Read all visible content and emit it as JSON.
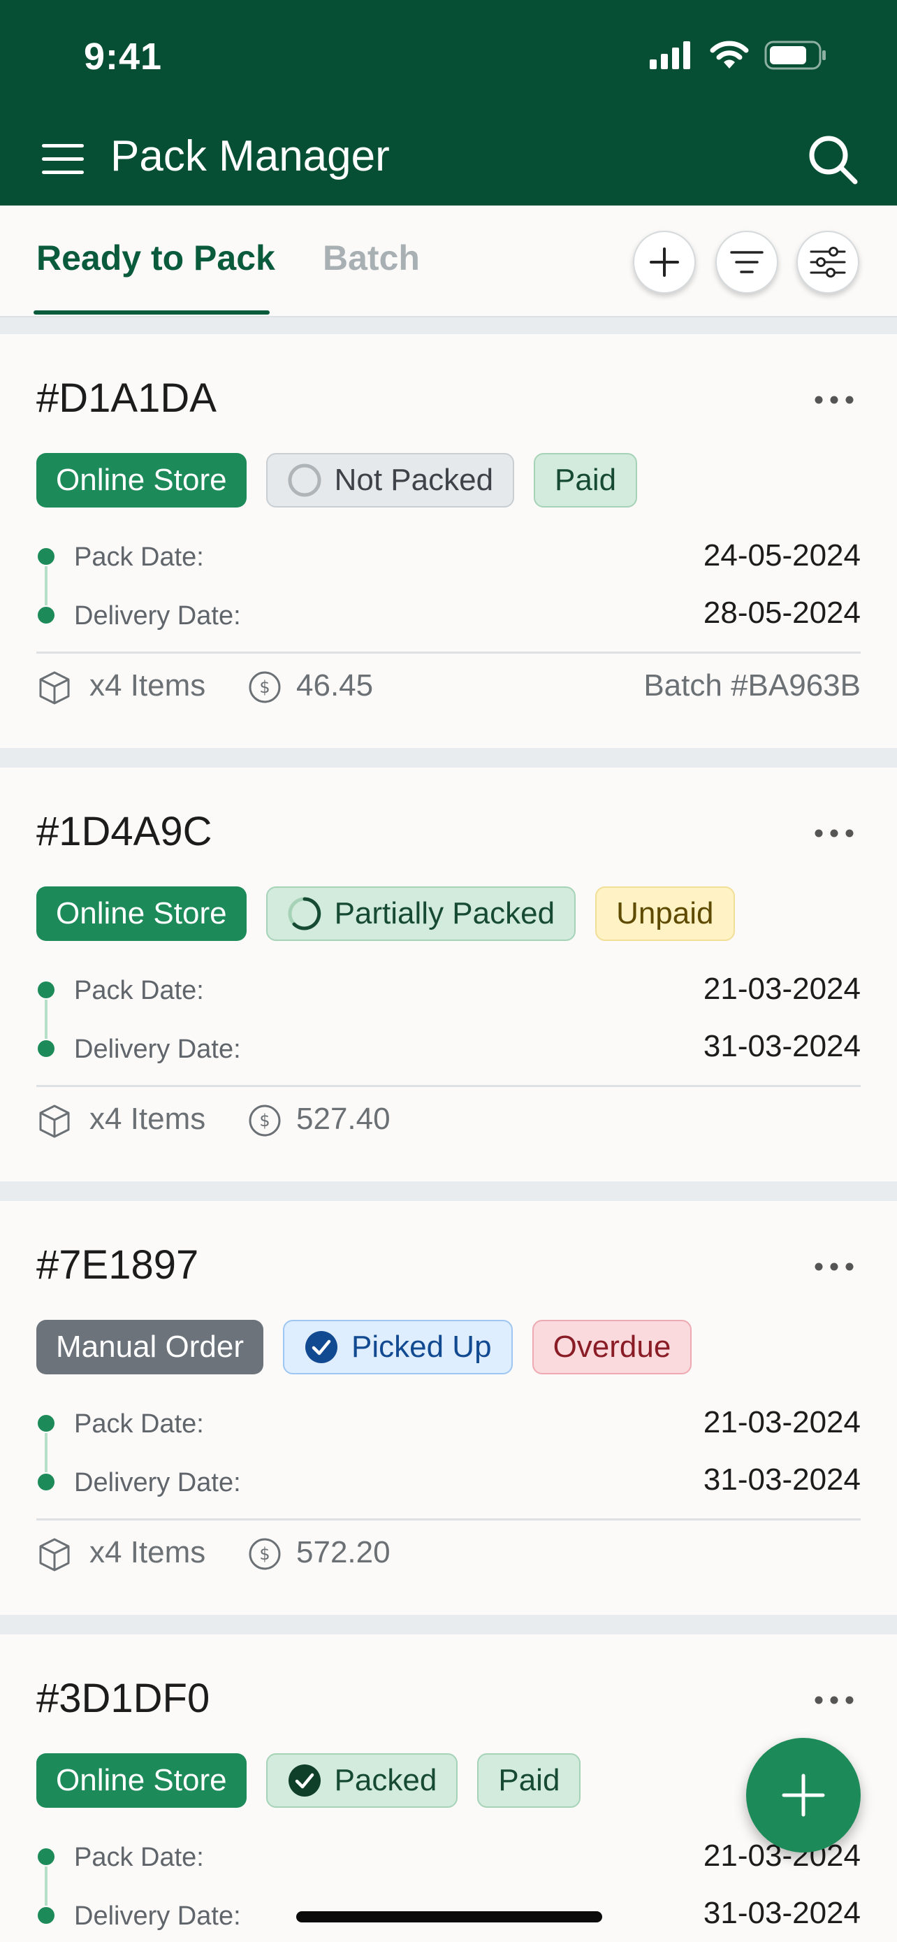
{
  "status_bar": {
    "time": "9:41"
  },
  "app": {
    "title": "Pack Manager"
  },
  "tabs": [
    {
      "label": "Ready to Pack"
    },
    {
      "label": "Batch"
    }
  ],
  "orders": [
    {
      "id": "#D1A1DA",
      "source": "Online Store",
      "pack_status": "Not Packed",
      "payment_status": "Paid",
      "pack_date_label": "Pack Date:",
      "pack_date": "24-05-2024",
      "delivery_date_label": "Delivery Date:",
      "delivery_date": "28-05-2024",
      "items": "x4 Items",
      "amount": "46.45",
      "batch": "Batch #BA963B"
    },
    {
      "id": "#1D4A9C",
      "source": "Online Store",
      "pack_status": "Partially Packed",
      "payment_status": "Unpaid",
      "pack_date_label": "Pack Date:",
      "pack_date": "21-03-2024",
      "delivery_date_label": "Delivery Date:",
      "delivery_date": "31-03-2024",
      "items": "x4 Items",
      "amount": "527.40"
    },
    {
      "id": "#7E1897",
      "source": "Manual Order",
      "pack_status": "Picked Up",
      "payment_status": "Overdue",
      "pack_date_label": "Pack Date:",
      "pack_date": "21-03-2024",
      "delivery_date_label": "Delivery Date:",
      "delivery_date": "31-03-2024",
      "items": "x4 Items",
      "amount": "572.20"
    },
    {
      "id": "#3D1DF0",
      "source": "Online Store",
      "pack_status": "Packed",
      "payment_status": "Paid",
      "pack_date_label": "Pack Date:",
      "pack_date": "21-03-2024",
      "delivery_date_label": "Delivery Date:",
      "delivery_date": "31-03-2024"
    }
  ],
  "colors": {
    "header": "#064f35",
    "accent": "#1d8a59",
    "tab_active": "#0a5b3c",
    "tab_inactive": "#a9b0b4"
  },
  "icons": {
    "menu": "hamburger-icon",
    "search": "search-icon",
    "add": "plus-icon",
    "sort": "sort-lines-icon",
    "filter": "sliders-icon",
    "more": "ellipsis-icon",
    "items": "box-icon",
    "amount": "dollar-coin-icon"
  }
}
